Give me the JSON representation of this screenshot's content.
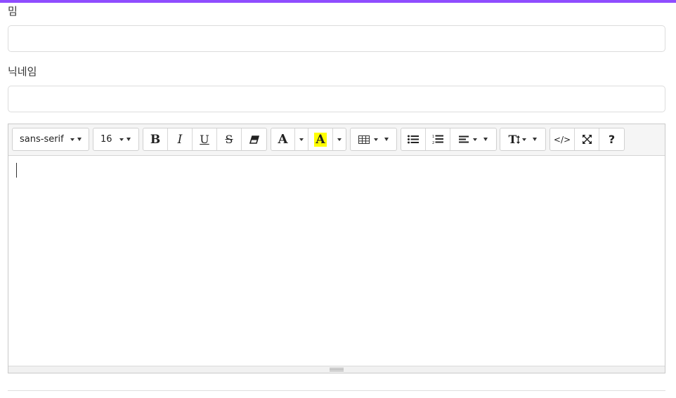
{
  "theme": {
    "accent": "#8f4dff",
    "highlight": "#ffff00"
  },
  "form": {
    "field1_label": "밈",
    "field1_value": "",
    "field2_label": "닉네임",
    "field2_value": ""
  },
  "editor": {
    "font_family": "sans-serif",
    "font_size": "16",
    "content": "",
    "toolbar": {
      "bold": "B",
      "italic": "I",
      "underline": "U",
      "strikethrough": "S",
      "font_color": "A",
      "highlight_color": "A",
      "style": "T",
      "code_view": "</>",
      "help": "?"
    },
    "icons": [
      "eraser-icon",
      "table-icon",
      "unordered-list-icon",
      "ordered-list-icon",
      "align-icon",
      "line-height-icon",
      "fullscreen-icon",
      "resize-grip-icon"
    ]
  }
}
